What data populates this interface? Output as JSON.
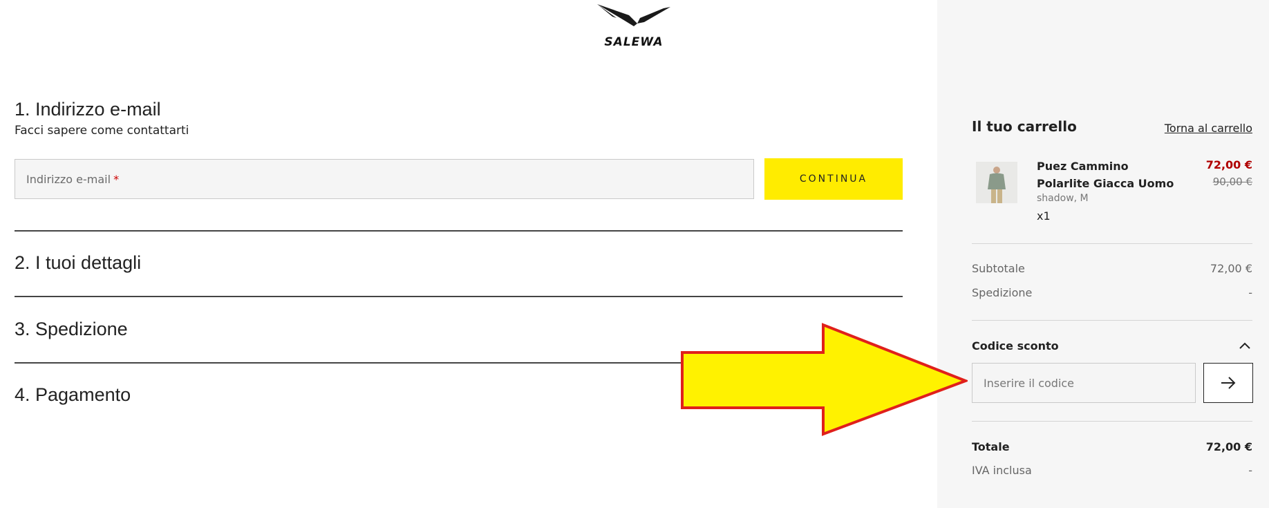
{
  "brand": {
    "logo_text": "SALEWA"
  },
  "steps": {
    "email": {
      "title": "1. Indirizzo e-mail",
      "subtitle": "Facci sapere come contattarti",
      "placeholder": "Indirizzo e-mail",
      "required_mark": "*",
      "continue_label": "CONTINUA"
    },
    "details": {
      "title": "2. I tuoi dettagli"
    },
    "shipping": {
      "title": "3. Spedizione"
    },
    "payment": {
      "title": "4. Pagamento"
    }
  },
  "cart": {
    "title": "Il tuo carrello",
    "back_link": "Torna al carrello",
    "item": {
      "name": "Puez Cammino Polarlite Giacca Uomo",
      "variant": "shadow, M",
      "quantity": "x1",
      "price": "72,00 €",
      "original_price": "90,00 €"
    },
    "subtotal_label": "Subtotale",
    "subtotal_value": "72,00 €",
    "shipping_label": "Spedizione",
    "shipping_value": "-",
    "discount": {
      "title": "Codice sconto",
      "placeholder": "Inserire il codice"
    },
    "total_label": "Totale",
    "total_value": "72,00 €",
    "vat_label": "IVA inclusa",
    "vat_value": "-"
  },
  "colors": {
    "accent_yellow": "#ffec00",
    "sale_red": "#b00000",
    "annotation_arrow_fill": "#fff200",
    "annotation_arrow_stroke": "#e0201b",
    "cart_background": "#f6f6f6"
  },
  "icons": {
    "logo": "salewa-eagle-logo",
    "discount_toggle": "chevron-up-icon",
    "apply_code": "arrow-right-icon",
    "annotation": "yellow-arrow-pointer"
  }
}
